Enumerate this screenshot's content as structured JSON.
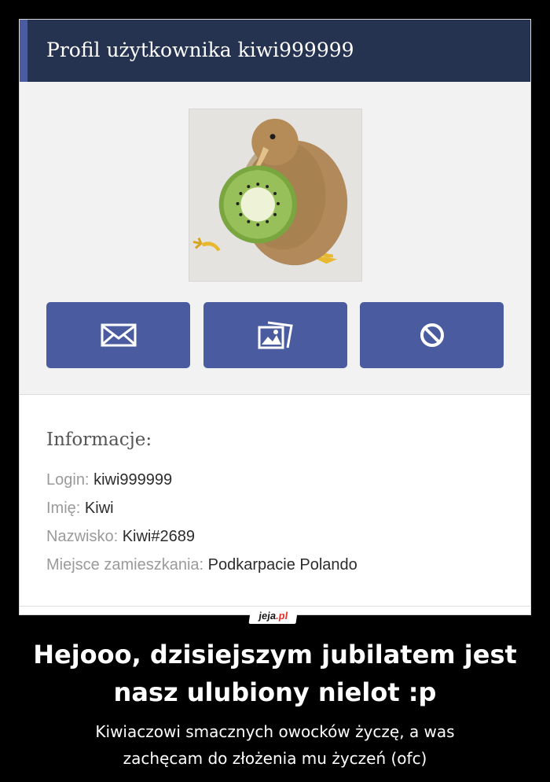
{
  "profile": {
    "header_title": "Profil użytkownika kiwi999999",
    "avatar_alt": "kiwi bird holding a kiwi slice"
  },
  "actions": [
    {
      "name": "message",
      "icon": "envelope-icon"
    },
    {
      "name": "gallery",
      "icon": "photo-gallery-icon"
    },
    {
      "name": "block",
      "icon": "block-icon"
    }
  ],
  "info": {
    "title": "Informacje:",
    "rows": [
      {
        "label": "Login:",
        "value": "kiwi999999"
      },
      {
        "label": "Imię:",
        "value": "Kiwi"
      },
      {
        "label": "Nazwisko:",
        "value": "Kiwi#2689"
      },
      {
        "label": "Miejsce zamieszkania:",
        "value": "Podkarpacie Polando"
      }
    ]
  },
  "watermark": {
    "name": "jeja",
    "dot": ".",
    "tld": "pl"
  },
  "caption": {
    "title_line1": "Hejooo, dzisiejszym jubilatem jest",
    "title_line2": "nasz ulubiony nielot :p",
    "sub_line1": "Kiwiaczowi smacznych owocków życzę, a was",
    "sub_line2": "zachęcam do złożenia mu życzeń (ofc)"
  },
  "colors": {
    "header_bg": "#253250",
    "accent": "#4a5c9f",
    "page_bg": "#000000"
  }
}
